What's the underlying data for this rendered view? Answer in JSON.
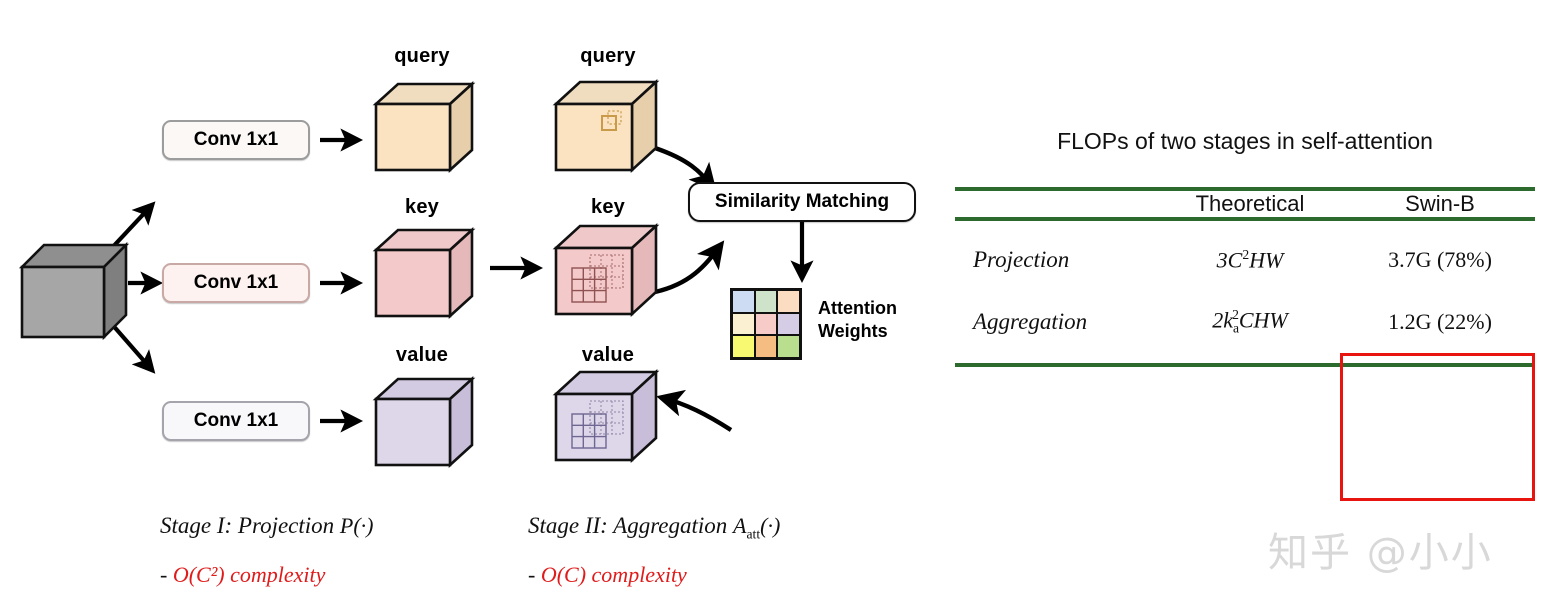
{
  "diagram": {
    "input_cube": {
      "name": "input-feature-cube",
      "color": "#9a9a9a"
    },
    "conv_boxes": [
      {
        "label": "Conv 1x1",
        "branch": "query"
      },
      {
        "label": "Conv 1x1",
        "branch": "key"
      },
      {
        "label": "Conv 1x1",
        "branch": "value"
      }
    ],
    "stage1_cubes": [
      {
        "label": "query",
        "color": "#fae0bc"
      },
      {
        "label": "key",
        "color": "#f2c3c3"
      },
      {
        "label": "value",
        "color": "#dcd3e8"
      }
    ],
    "stage2_cubes": [
      {
        "label": "query",
        "color": "#fae0bc"
      },
      {
        "label": "key",
        "color": "#f2c3c3"
      },
      {
        "label": "value",
        "color": "#dcd3e8"
      }
    ],
    "similarity_box": {
      "label": "Similarity Matching"
    },
    "attention": {
      "label_line1": "Attention",
      "label_line2": "Weights",
      "cells": [
        "#cddcf2",
        "#cfe3cb",
        "#fbddc2",
        "#fbf0d2",
        "#f6cbc8",
        "#d5cde6",
        "#f8f871",
        "#f6bd82",
        "#b9de8e"
      ]
    },
    "captions": [
      {
        "title_prefix": "Stage I: Projection",
        "operator": "P",
        "operator_sub": "",
        "operator_arg": "(·)",
        "complexity_prefix": "-",
        "complexity": "O(C²) complexity"
      },
      {
        "title_prefix": "Stage II: Aggregation",
        "operator": "A",
        "operator_sub": "att",
        "operator_arg": "(·)",
        "complexity_prefix": "-",
        "complexity": "O(C) complexity"
      }
    ]
  },
  "table": {
    "title": "FLOPs of two stages in self-attention",
    "columns": [
      "",
      "Theoretical",
      "Swin-B"
    ],
    "rows": [
      {
        "label": "Projection",
        "theoretical_base": "3C",
        "theoretical_sup": "2",
        "theoretical_tail": "HW",
        "swin_b": "3.7G (78%)"
      },
      {
        "label": "Aggregation",
        "theoretical_base": "2k",
        "theoretical_sub": "a",
        "theoretical_sup": "2",
        "theoretical_tail": "CHW",
        "swin_b": "1.2G (22%)"
      }
    ],
    "highlight_color": "#e8140f",
    "rule_color": "#2d6a2d"
  },
  "watermark": {
    "text": "知乎 @小小"
  }
}
